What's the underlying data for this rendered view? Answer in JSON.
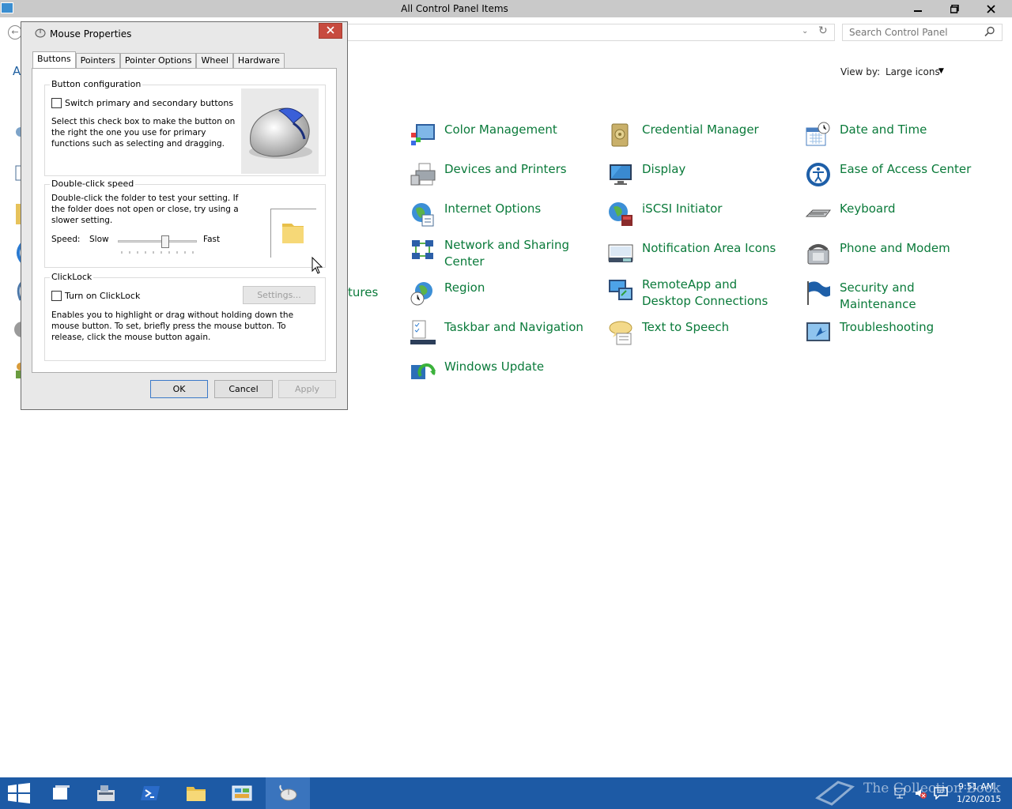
{
  "control_panel": {
    "title": "All Control Panel Items",
    "search_placeholder": "Search Control Panel",
    "view_by_label": "View by:",
    "view_by_value": "Large icons",
    "left_fragment_link": "A",
    "partial_item": "tures",
    "items": [
      {
        "label": "Color Management"
      },
      {
        "label": "Credential Manager"
      },
      {
        "label": "Date and Time"
      },
      {
        "label": "Devices and Printers"
      },
      {
        "label": "Display"
      },
      {
        "label": "Ease of Access Center"
      },
      {
        "label": "Internet Options"
      },
      {
        "label": "iSCSI Initiator"
      },
      {
        "label": "Keyboard"
      },
      {
        "label": "Network and Sharing Center"
      },
      {
        "label": "Notification Area Icons"
      },
      {
        "label": "Phone and Modem"
      },
      {
        "label": "Region"
      },
      {
        "label": "RemoteApp and Desktop Connections"
      },
      {
        "label": "Security and Maintenance"
      },
      {
        "label": "Taskbar and Navigation"
      },
      {
        "label": "Text to Speech"
      },
      {
        "label": "Troubleshooting"
      },
      {
        "label": "Windows Update"
      }
    ]
  },
  "dialog": {
    "title": "Mouse Properties",
    "tabs": [
      "Buttons",
      "Pointers",
      "Pointer Options",
      "Wheel",
      "Hardware"
    ],
    "button_config": {
      "title": "Button configuration",
      "checkbox_label": "Switch primary and secondary buttons",
      "description": "Select this check box to make the button on the right the one you use for primary functions such as selecting and dragging."
    },
    "double_click": {
      "title": "Double-click speed",
      "description": "Double-click the folder to test your setting. If the folder does not open or close, try using a slower setting.",
      "speed_label": "Speed:",
      "slow_label": "Slow",
      "fast_label": "Fast",
      "speed_level": 0.6
    },
    "clicklock": {
      "title": "ClickLock",
      "checkbox_label": "Turn on ClickLock",
      "settings_button": "Settings...",
      "description": "Enables you to highlight or drag without holding down the mouse button. To set, briefly press the mouse button. To release, click the mouse button again."
    },
    "ok": "OK",
    "cancel": "Cancel",
    "apply": "Apply"
  },
  "taskbar": {
    "watermark": "The Collection Book",
    "time": "9:51 AM",
    "date": "1/20/2015"
  },
  "colors": {
    "link_green": "#0a7a3a",
    "taskbar_blue": "#1d5aa5",
    "close_red": "#c74b3f"
  }
}
